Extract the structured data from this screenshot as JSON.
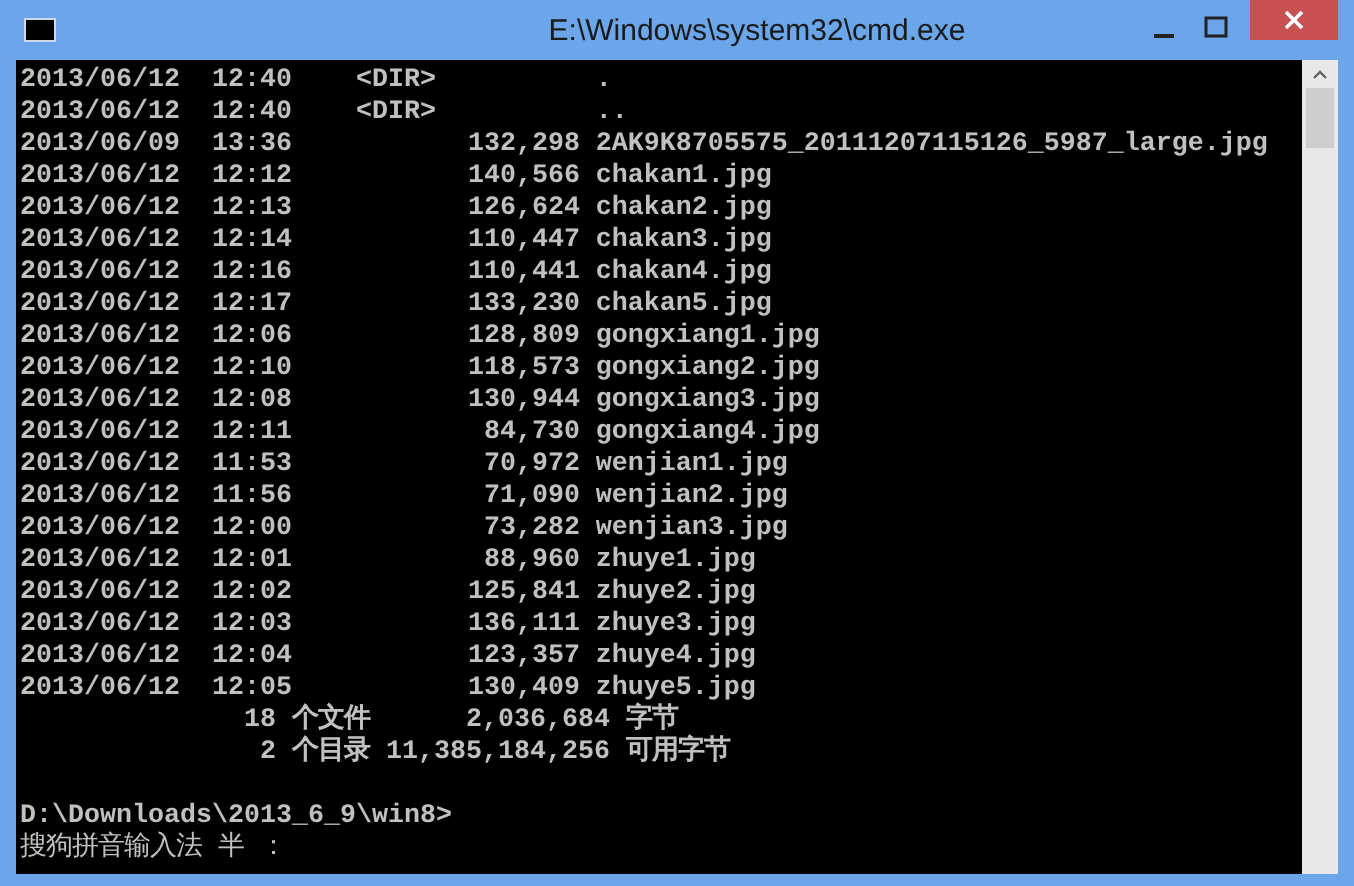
{
  "window": {
    "title": "E:\\Windows\\system32\\cmd.exe"
  },
  "listing": [
    {
      "kind": "dir",
      "date": "2013/06/12",
      "time": "12:40",
      "size": "<DIR>",
      "name": "."
    },
    {
      "kind": "dir",
      "date": "2013/06/12",
      "time": "12:40",
      "size": "<DIR>",
      "name": ".."
    },
    {
      "kind": "file",
      "date": "2013/06/09",
      "time": "13:36",
      "size": "132,298",
      "name": "2AK9K8705575_20111207115126_5987_large.jpg"
    },
    {
      "kind": "file",
      "date": "2013/06/12",
      "time": "12:12",
      "size": "140,566",
      "name": "chakan1.jpg"
    },
    {
      "kind": "file",
      "date": "2013/06/12",
      "time": "12:13",
      "size": "126,624",
      "name": "chakan2.jpg"
    },
    {
      "kind": "file",
      "date": "2013/06/12",
      "time": "12:14",
      "size": "110,447",
      "name": "chakan3.jpg"
    },
    {
      "kind": "file",
      "date": "2013/06/12",
      "time": "12:16",
      "size": "110,441",
      "name": "chakan4.jpg"
    },
    {
      "kind": "file",
      "date": "2013/06/12",
      "time": "12:17",
      "size": "133,230",
      "name": "chakan5.jpg"
    },
    {
      "kind": "file",
      "date": "2013/06/12",
      "time": "12:06",
      "size": "128,809",
      "name": "gongxiang1.jpg"
    },
    {
      "kind": "file",
      "date": "2013/06/12",
      "time": "12:10",
      "size": "118,573",
      "name": "gongxiang2.jpg"
    },
    {
      "kind": "file",
      "date": "2013/06/12",
      "time": "12:08",
      "size": "130,944",
      "name": "gongxiang3.jpg"
    },
    {
      "kind": "file",
      "date": "2013/06/12",
      "time": "12:11",
      "size": "84,730",
      "name": "gongxiang4.jpg"
    },
    {
      "kind": "file",
      "date": "2013/06/12",
      "time": "11:53",
      "size": "70,972",
      "name": "wenjian1.jpg"
    },
    {
      "kind": "file",
      "date": "2013/06/12",
      "time": "11:56",
      "size": "71,090",
      "name": "wenjian2.jpg"
    },
    {
      "kind": "file",
      "date": "2013/06/12",
      "time": "12:00",
      "size": "73,282",
      "name": "wenjian3.jpg"
    },
    {
      "kind": "file",
      "date": "2013/06/12",
      "time": "12:01",
      "size": "88,960",
      "name": "zhuye1.jpg"
    },
    {
      "kind": "file",
      "date": "2013/06/12",
      "time": "12:02",
      "size": "125,841",
      "name": "zhuye2.jpg"
    },
    {
      "kind": "file",
      "date": "2013/06/12",
      "time": "12:03",
      "size": "136,111",
      "name": "zhuye3.jpg"
    },
    {
      "kind": "file",
      "date": "2013/06/12",
      "time": "12:04",
      "size": "123,357",
      "name": "zhuye4.jpg"
    },
    {
      "kind": "file",
      "date": "2013/06/12",
      "time": "12:05",
      "size": "130,409",
      "name": "zhuye5.jpg"
    }
  ],
  "summary": [
    {
      "count": "18",
      "label": "个文件",
      "bytes": "2,036,684",
      "unit": "字节"
    },
    {
      "count": "2",
      "label": "个目录",
      "bytes": "11,385,184,256",
      "unit": "可用字节"
    }
  ],
  "prompt": "D:\\Downloads\\2013_6_9\\win8>",
  "ime_status": "搜狗拼音输入法 半 ："
}
